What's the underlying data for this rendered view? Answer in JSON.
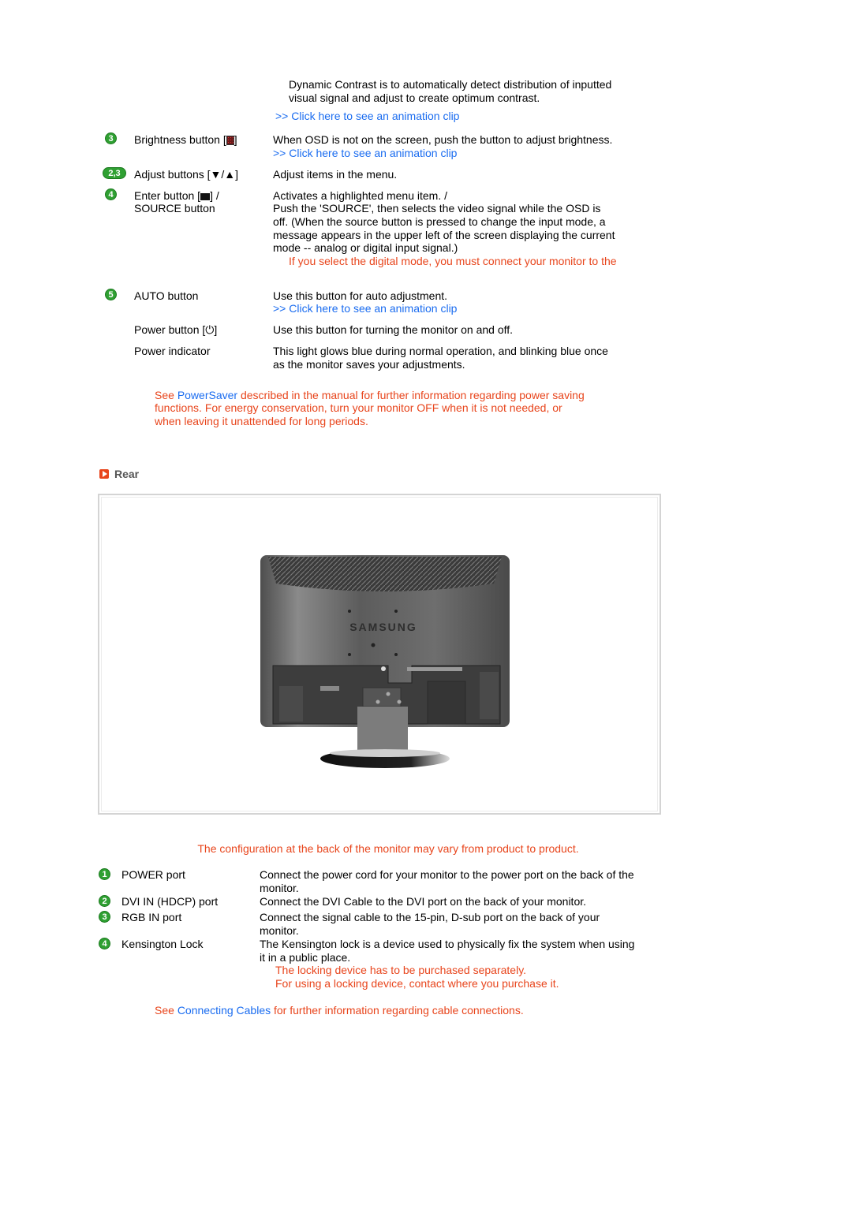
{
  "front": {
    "dynamic_contrast": {
      "desc_line1": "Dynamic Contrast is to automatically detect distribution of inputted",
      "desc_line2": "visual signal and adjust to create optimum contrast.",
      "link": ">> Click here to see an animation clip"
    },
    "items": [
      {
        "badge": "3",
        "label": "Brightness button [",
        "label_suffix": "]",
        "desc": "When OSD is not on the screen, push the button to adjust brightness.",
        "link": ">> Click here to see an animation clip"
      },
      {
        "badge": "2,3",
        "label": "Adjust buttons [▼/▲]",
        "desc": "Adjust items in the menu."
      },
      {
        "badge": "4",
        "label_line1": "Enter button [",
        "label_line1_suffix": "] /",
        "label_line2": "SOURCE button",
        "desc_lines": [
          "Activates a highlighted menu item. /",
          "Push the 'SOURCE', then selects the video signal while the OSD is",
          "off. (When the source button is pressed to change the input mode, a",
          "message appears in the upper left of the screen displaying the current",
          "mode -- analog or digital input signal.)"
        ],
        "note": "If you select the digital mode, you must connect your monitor to the"
      },
      {
        "badge": "5",
        "label": "AUTO button",
        "desc": "Use this button for auto adjustment.",
        "link": ">> Click here to see an animation clip"
      },
      {
        "label": "Power button [⏻]",
        "desc": "Use this button for turning the monitor on and off."
      },
      {
        "label": "Power indicator",
        "desc_lines": [
          "This light glows blue during normal operation, and blinking blue once",
          "as the monitor saves your adjustments."
        ]
      }
    ],
    "powersaver_note": {
      "prefix": "See ",
      "link": "PowerSaver",
      "line1_rest": " described in the manual for further information regarding power saving",
      "line2": "functions. For energy conservation, turn your monitor OFF when it is not needed, or",
      "line3": "when leaving it unattended for long periods."
    }
  },
  "rear": {
    "heading": "Rear",
    "image_brand": "SAMSUNG",
    "config_note": "The configuration at the back of the monitor may vary from product to product.",
    "ports": [
      {
        "badge": "1",
        "label": "POWER port",
        "desc_lines": [
          "Connect the power cord for your monitor to the power port on the back of the",
          "monitor."
        ]
      },
      {
        "badge": "2",
        "label": "DVI IN (HDCP) port",
        "desc_lines": [
          "Connect the DVI Cable to the DVI port on the back of your monitor."
        ]
      },
      {
        "badge": "3",
        "label": "RGB IN port",
        "desc_lines": [
          "Connect the signal cable to the 15-pin, D-sub port on the back of your",
          "monitor."
        ]
      },
      {
        "badge": "4",
        "label": "Kensington Lock",
        "desc_lines": [
          "The Kensington lock is a device used to physically fix the system when using",
          "it in a public place."
        ],
        "notes": [
          "The locking device has to be purchased separately.",
          "For using a locking device, contact where you purchase it."
        ]
      }
    ],
    "cables_note": {
      "prefix": "See ",
      "link": "Connecting Cables",
      "rest": " for further information regarding cable connections."
    }
  }
}
